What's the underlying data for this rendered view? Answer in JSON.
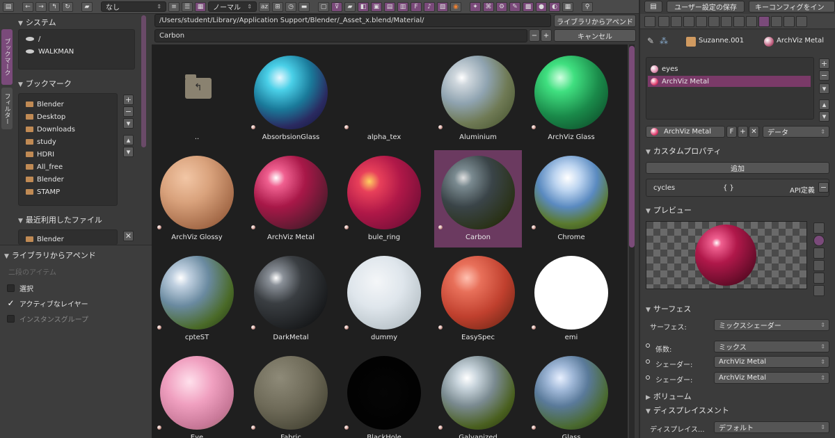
{
  "toolbar": {
    "filter_dropdown": "なし",
    "display_dropdown": "ノーマル",
    "left_icons": [
      "file-browser-icon",
      "back-arrow-icon",
      "forward-arrow-icon",
      "parent-dir-icon",
      "refresh-icon",
      "new-folder-icon"
    ],
    "view_icons": [
      "list-short-icon",
      "list-long-icon",
      "thumbnails-icon"
    ],
    "sort_icons": [
      "sort-alpha-icon",
      "sort-ext-icon",
      "sort-time-icon",
      "sort-size-icon"
    ],
    "filter_icons": [
      "hide-dot-icon",
      "filter-icon",
      "folder-filter-icon",
      "blend-filter-icon",
      "image-filter-icon",
      "movie-filter-icon",
      "script-filter-icon",
      "font-filter-icon",
      "sound-filter-icon",
      "text-filter-icon",
      "blender-icon"
    ]
  },
  "left": {
    "tabs": [
      "ブックマーク",
      "フィルター"
    ],
    "system_title": "システム",
    "system_items": [
      "/",
      "WALKMAN"
    ],
    "bookmarks_title": "ブックマーク",
    "bookmarks": [
      "Blender",
      "Desktop",
      "Downloads",
      "study",
      "HDRI",
      "All_free",
      "Blender",
      "STAMP"
    ],
    "recent_title": "最近利用したファイル",
    "recent": [
      "Blender"
    ],
    "append_title": "ライブラリからアペンド",
    "append_subtitle": "二段のアイテム",
    "options": [
      {
        "label": "選択",
        "checked": false
      },
      {
        "label": "アクティブなレイヤー",
        "checked": true
      },
      {
        "label": "インスタンスグループ",
        "checked": false
      }
    ]
  },
  "browser": {
    "path": "/Users/student/Library/Application Support/Blender/_Asset_x.blend/Material/",
    "filename": "Carbon",
    "append_button": "ライブラリからアペンド",
    "cancel_button": "キャンセル",
    "parent_label": "..",
    "items": [
      {
        "name": "AbsorbsionGlass",
        "style": "radial-gradient(circle at 35% 30%, #e8f8ff 0%, #4ad0e8 18%, #1a7a9a 45%, #2a2a60 70%, #0a1030 100%)"
      },
      {
        "name": "alpha_tex",
        "style": "transparent"
      },
      {
        "name": "Aluminium",
        "style": "radial-gradient(circle at 28% 30%, #ffffff 0%, #cfd7dd 10%, #8fa3b0 35%, #6f7a55 62%, #3d4a25 100%)"
      },
      {
        "name": "ArchViz Glass",
        "style": "radial-gradient(circle at 35% 30%, #d0ffe0 0%, #40e080 20%, #1a8a4a 55%, #0a3a20 100%)"
      },
      {
        "name": "ArchViz Glossy",
        "style": "radial-gradient(circle at 35% 30%, #f2c6a5 0%, #d9a27c 35%, #a46a48 75%, #6a3e28 100%)"
      },
      {
        "name": "ArchViz Metal",
        "style": "radial-gradient(circle at 30% 30%, #ffffff 0%, #f06090 12%, #a81848 40%, #5a1a30 75%, #2a0a18 100%)"
      },
      {
        "name": "bule_ring",
        "style": "radial-gradient(circle at 30% 35%, #ffd060 0%, #e8405a 15%, #b01848 45%, #5a0a30 100%)"
      },
      {
        "name": "Carbon",
        "style": "radial-gradient(circle at 30% 30%, #e0e0e0 0%, #7a8a90 12%, #3a4448 40%, #2a3218 75%, #101408 100%)"
      },
      {
        "name": "Chrome",
        "style": "radial-gradient(circle at 45% 30%, #ffffff 0%, #bcd4f0 20%, #5a8ac0 45%, #5a7a30 70%, #2a4010 100%)"
      },
      {
        "name": "cpteST",
        "style": "radial-gradient(circle at 28% 30%, #ffffff 0%, #c0d0e0 12%, #6a8aa0 38%, #4a6a28 70%, #1e3010 100%)"
      },
      {
        "name": "DarkMetal",
        "style": "radial-gradient(circle at 30% 30%, #ffffff 0%, #8a9098 10%, #3a3e42 35%, #1a1c1e 75%, #050505 100%)"
      },
      {
        "name": "dummy",
        "style": "radial-gradient(circle at 40% 35%, #f4f6f8 0%, #dfe6ec 40%, #b8c2c8 80%, #8a9298 100%)"
      },
      {
        "name": "EasySpec",
        "style": "radial-gradient(circle at 35% 30%, #ffc0b0 0%, #e8705a 20%, #c0402e 55%, #5a2010 100%)"
      },
      {
        "name": "emi",
        "style": "radial-gradient(circle at 50% 50%, #ffffff 0%, #ffffff 100%)"
      },
      {
        "name": "Eye",
        "style": "radial-gradient(circle at 40% 35%, #ffe0ec 0%, #f0a0c0 35%, #c87898 70%, #8a6a5a 100%)"
      },
      {
        "name": "Fabric",
        "style": "radial-gradient(circle at 35% 30%, #8e8a78 0%, #6e6a58 45%, #4a4838 80%, #2e2c20 100%)"
      },
      {
        "name": "BlackHole",
        "style": "radial-gradient(circle at 50% 50%, #050505 0%, #000000 100%)"
      },
      {
        "name": "Galvanized",
        "style": "radial-gradient(circle at 35% 30%, #ffffff 0%, #c8d4dc 15%, #7a8a90 40%, #4a6020 70%, #1e2a08 100%)"
      },
      {
        "name": "Glass",
        "style": "radial-gradient(circle at 35% 30%, #e8f0ff 0%, #a0b8d8 18%, #5a7a9a 40%, #4a6a30 70%, #1e3010 100%)"
      }
    ]
  },
  "right": {
    "top_buttons": [
      "ユーザー設定の保存",
      "キーコンフィグをイン"
    ],
    "object_name": "Suzanne.001",
    "material_name": "ArchViz Metal",
    "slots": [
      "eyes",
      "ArchViz Metal"
    ],
    "material_field": "ArchViz Metal",
    "f_label": "F",
    "data_dropdown": "データ",
    "custom_props_title": "カスタムプロパティ",
    "add_button": "追加",
    "prop_name": "cycles",
    "prop_value": "{ }",
    "prop_api": "API定義",
    "preview_title": "プレビュー",
    "surface_title": "サーフェス",
    "surface_label": "サーフェス:",
    "surface_value": "ミックスシェーダー",
    "factor_label": "係数:",
    "factor_value": "ミックス",
    "shader1_label": "シェーダー:",
    "shader1_value": "ArchViz Metal",
    "shader2_label": "シェーダー:",
    "shader2_value": "ArchViz Metal",
    "volume_title": "ボリューム",
    "displacement_title": "ディスプレイスメント",
    "displacement_label": "ディスプレイス...",
    "displacement_value": "デフォルト"
  }
}
